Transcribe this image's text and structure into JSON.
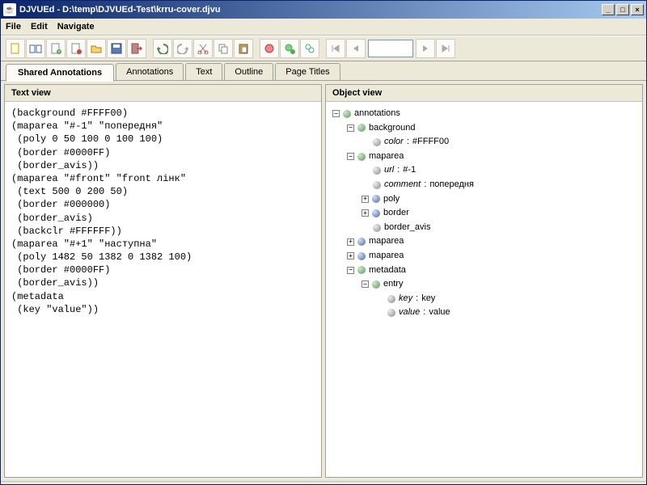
{
  "titlebar": {
    "text": "DJVUEd - D:\\temp\\DJVUEd-Test\\krru-cover.djvu"
  },
  "menu": {
    "file": "File",
    "edit": "Edit",
    "navigate": "Navigate"
  },
  "tabs": {
    "shared_annotations": "Shared Annotations",
    "annotations": "Annotations",
    "text": "Text",
    "outline": "Outline",
    "page_titles": "Page Titles"
  },
  "panels": {
    "text_view": "Text view",
    "object_view": "Object view"
  },
  "text_content": "(background #FFFF00)\n(maparea \"#-1\" \"попередня\"\n (poly 0 50 100 0 100 100)\n (border #0000FF)\n (border_avis))\n(maparea \"#front\" \"front лінк\"\n (text 500 0 200 50)\n (border #000000)\n (border_avis)\n (backclr #FFFFFF))\n(maparea \"#+1\" \"наступна\"\n (poly 1482 50 1382 0 1382 100)\n (border #0000FF)\n (border_avis))\n(metadata\n (key \"value\"))",
  "tree": {
    "annotations": "annotations",
    "background": "background",
    "color_key": "color",
    "color_val": "#FFFF00",
    "maparea": "maparea",
    "url_key": "url",
    "url_val": "#-1",
    "comment_key": "comment",
    "comment_val": "попередня",
    "poly": "poly",
    "border": "border",
    "border_avis": "border_avis",
    "metadata": "metadata",
    "entry": "entry",
    "key_key": "key",
    "key_val": "key",
    "value_key": "value",
    "value_val": "value"
  }
}
